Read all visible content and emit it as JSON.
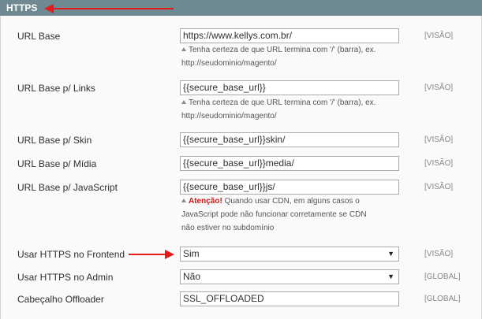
{
  "section": {
    "title": "HTTPS"
  },
  "rows": [
    {
      "label": "URL Base",
      "value": "https://www.kellys.com.br/",
      "scope": "[VISÃO]",
      "note_line1": "Tenha certeza de que URL termina com '/' (barra), ex.",
      "note_line2": "http://seudominio/magento/"
    },
    {
      "label": "URL Base p/ Links",
      "value": "{{secure_base_url}}",
      "scope": "[VISÃO]",
      "note_line1": "Tenha certeza de que URL termina com '/' (barra), ex.",
      "note_line2": "http://seudominio/magento/"
    },
    {
      "label": "URL Base p/ Skin",
      "value": "{{secure_base_url}}skin/",
      "scope": "[VISÃO]"
    },
    {
      "label": "URL Base p/ Mídia",
      "value": "{{secure_base_url}}media/",
      "scope": "[VISÃO]"
    },
    {
      "label": "URL Base p/ JavaScript",
      "value": "{{secure_base_url}}js/",
      "scope": "[VISÃO]",
      "note_warn": "Atenção!",
      "note_line1": " Quando usar CDN, em alguns casos o",
      "note_line2": "JavaScript pode não funcionar corretamente se CDN",
      "note_line3": "não estiver no subdomínio"
    },
    {
      "label": "Usar HTTPS no Frontend",
      "value": "Sim",
      "scope": "[VISÃO]"
    },
    {
      "label": "Usar HTTPS no Admin",
      "value": "Não",
      "scope": "[GLOBAL]"
    },
    {
      "label": "Cabeçalho Offloader",
      "value": "SSL_OFFLOADED",
      "scope": "[GLOBAL]"
    }
  ],
  "icons": {
    "dropdown": "▼",
    "hint": "triangle-up-icon",
    "annotation": "red-arrow-icon"
  },
  "colors": {
    "header_bg": "#6f8992",
    "warning": "#d41616",
    "annotation_arrow": "#e31b1b"
  }
}
